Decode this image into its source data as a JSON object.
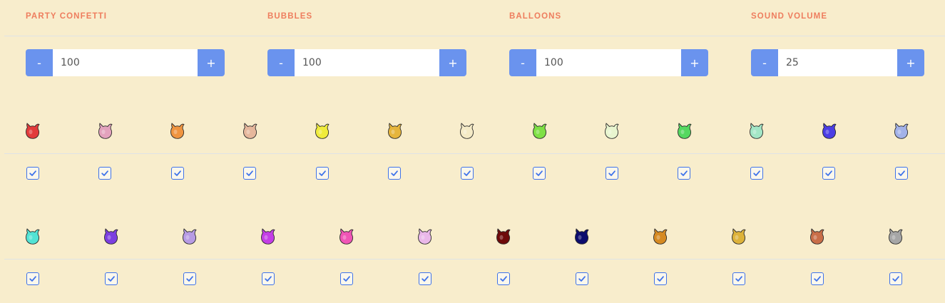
{
  "settings": [
    {
      "label": "PARTY CONFETTI",
      "value": "100",
      "minus": "-",
      "plus": "+"
    },
    {
      "label": "BUBBLES",
      "value": "100",
      "minus": "-",
      "plus": "+"
    },
    {
      "label": "BALLOONS",
      "value": "100",
      "minus": "-",
      "plus": "+"
    },
    {
      "label": "SOUND VOLUME",
      "value": "25",
      "minus": "-",
      "plus": "+"
    }
  ],
  "colors_row1": [
    {
      "name": "red",
      "fill": "#e23b3b",
      "checked": true
    },
    {
      "name": "pink",
      "fill": "#e3a2bd",
      "checked": true
    },
    {
      "name": "orange",
      "fill": "#ef9440",
      "checked": true
    },
    {
      "name": "peach",
      "fill": "#e6b79c",
      "checked": true
    },
    {
      "name": "yellow",
      "fill": "#f0ec3c",
      "checked": true
    },
    {
      "name": "mustard",
      "fill": "#e6b53c",
      "checked": true
    },
    {
      "name": "cream",
      "fill": "#f4eac6",
      "checked": true
    },
    {
      "name": "lime",
      "fill": "#7fe044",
      "checked": true
    },
    {
      "name": "pale-green",
      "fill": "#e8f5cf",
      "checked": true
    },
    {
      "name": "green",
      "fill": "#55d860",
      "checked": true
    },
    {
      "name": "mint",
      "fill": "#a3e6c6",
      "checked": true
    },
    {
      "name": "royal-blue",
      "fill": "#4b3ee5",
      "checked": true
    },
    {
      "name": "periwinkle",
      "fill": "#a3b2e9",
      "checked": true
    }
  ],
  "colors_row2": [
    {
      "name": "turquoise",
      "fill": "#52e3d4",
      "checked": true
    },
    {
      "name": "violet",
      "fill": "#7c3fe0",
      "checked": true
    },
    {
      "name": "lavender",
      "fill": "#b79be4",
      "checked": true
    },
    {
      "name": "magenta",
      "fill": "#c43ee6",
      "checked": true
    },
    {
      "name": "hot-pink",
      "fill": "#f055b6",
      "checked": true
    },
    {
      "name": "light-pink",
      "fill": "#eab8e9",
      "checked": true
    },
    {
      "name": "maroon",
      "fill": "#6e0a0a",
      "checked": true
    },
    {
      "name": "navy",
      "fill": "#0c0c6e",
      "checked": true
    },
    {
      "name": "bronze",
      "fill": "#d68a22",
      "checked": true
    },
    {
      "name": "gold",
      "fill": "#ddb23a",
      "checked": true
    },
    {
      "name": "copper",
      "fill": "#c96e48",
      "checked": true
    },
    {
      "name": "silver",
      "fill": "#a6a6a6",
      "checked": true
    }
  ]
}
